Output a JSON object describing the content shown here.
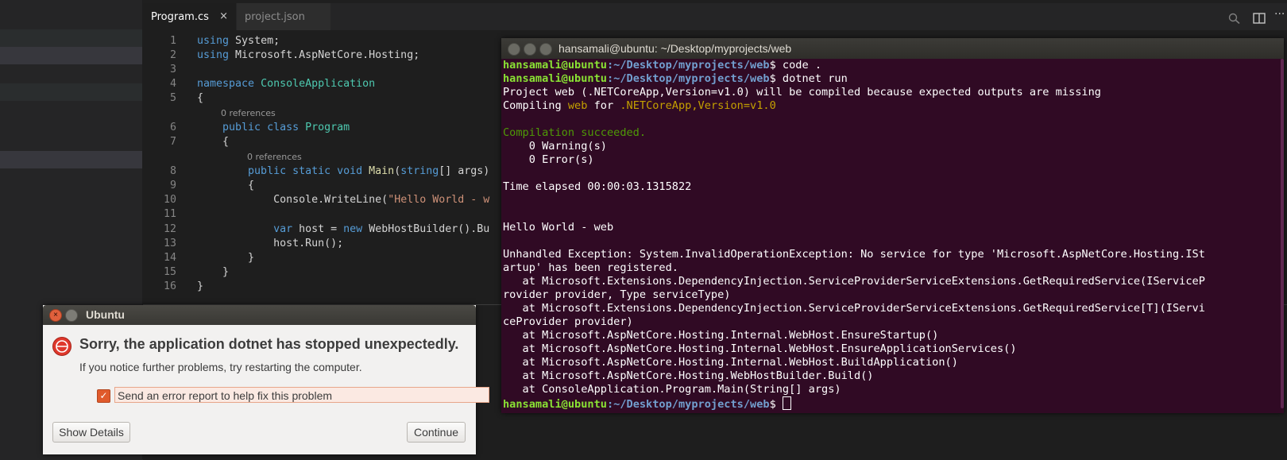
{
  "editor": {
    "tabs": [
      {
        "label": "Program.cs",
        "close": "×"
      },
      {
        "label": "project.json"
      }
    ],
    "lines": [
      {
        "n": "1",
        "parts": [
          [
            "kw",
            "using"
          ],
          [
            "",
            "System;"
          ]
        ]
      },
      {
        "n": "2",
        "parts": [
          [
            "kw",
            "using"
          ],
          [
            "",
            "Microsoft.AspNetCore.Hosting;"
          ]
        ]
      },
      {
        "n": "3",
        "parts": []
      },
      {
        "n": "4",
        "parts": [
          [
            "kw",
            "namespace"
          ],
          [
            "ty",
            "ConsoleApplication"
          ]
        ]
      },
      {
        "n": "5",
        "parts": [
          [
            "",
            "{"
          ]
        ]
      },
      {
        "n": "6",
        "parts": [
          [
            "kw",
            "public class"
          ],
          [
            "ty",
            "Program"
          ]
        ]
      },
      {
        "n": "7",
        "parts": [
          [
            "",
            "{"
          ]
        ]
      },
      {
        "n": "8",
        "parts": [
          [
            "kw",
            "public static void"
          ],
          [
            "fn",
            "Main"
          ],
          [
            "",
            "("
          ],
          [
            "kw",
            "string"
          ],
          [
            "",
            "[] args)"
          ]
        ]
      },
      {
        "n": "9",
        "parts": [
          [
            "",
            "{"
          ]
        ]
      },
      {
        "n": "10",
        "parts": [
          [
            "",
            "Console.WriteLine("
          ],
          [
            "st",
            "\"Hello World - w"
          ]
        ]
      },
      {
        "n": "11",
        "parts": []
      },
      {
        "n": "12",
        "parts": [
          [
            "kw",
            "var"
          ],
          [
            "",
            "host ="
          ],
          [
            "kw",
            "new"
          ],
          [
            "",
            "WebHostBuilder().Bu"
          ]
        ]
      },
      {
        "n": "13",
        "parts": [
          [
            "",
            "host.Run();"
          ]
        ]
      },
      {
        "n": "14",
        "parts": [
          [
            "",
            "}"
          ]
        ]
      },
      {
        "n": "15",
        "parts": [
          [
            "",
            "}"
          ]
        ]
      },
      {
        "n": "16",
        "parts": [
          [
            "",
            "}"
          ]
        ]
      }
    ],
    "references": "0 references"
  },
  "terminal": {
    "title": "hansamali@ubuntu: ~/Desktop/myprojects/web",
    "prompt_user": "hansamali@ubuntu",
    "prompt_path": ":~/Desktop/myprojects/web",
    "cmd1": "$ code .",
    "cmd2": "$ dotnet run",
    "out": [
      "Project web (.NETCoreApp,Version=v1.0) will be compiled because expected outputs are missing",
      "Compiling ",
      "web",
      " for ",
      ".NETCoreApp,Version=v1.0",
      "Compilation succeeded.",
      "    0 Warning(s)",
      "    0 Error(s)",
      "Time elapsed 00:00:03.1315822",
      "Hello World - web",
      "Unhandled Exception: System.InvalidOperationException: No service for type 'Microsoft.AspNetCore.Hosting.ISt",
      "artup' has been registered.",
      "   at Microsoft.Extensions.DependencyInjection.ServiceProviderServiceExtensions.GetRequiredService(IServiceP",
      "rovider provider, Type serviceType)",
      "   at Microsoft.Extensions.DependencyInjection.ServiceProviderServiceExtensions.GetRequiredService[T](IServi",
      "ceProvider provider)",
      "   at Microsoft.AspNetCore.Hosting.Internal.WebHost.EnsureStartup()",
      "   at Microsoft.AspNetCore.Hosting.Internal.WebHost.EnsureApplicationServices()",
      "   at Microsoft.AspNetCore.Hosting.Internal.WebHost.BuildApplication()",
      "   at Microsoft.AspNetCore.Hosting.WebHostBuilder.Build()",
      "   at ConsoleApplication.Program.Main(String[] args)"
    ],
    "final_prompt_end": "$ "
  },
  "dialog": {
    "title": "Ubuntu",
    "close_glyph": "×",
    "heading": "Sorry, the application dotnet has stopped unexpectedly.",
    "subtext": "If you notice further problems, try restarting the computer.",
    "checkbox_mark": "✓",
    "checkbox_label": "Send an error report to help fix this problem",
    "show_details": "Show Details",
    "continue": "Continue"
  },
  "icons": {
    "toolbar": [
      "split-editor-icon",
      "open-changes-icon",
      "more-actions-icon"
    ],
    "more_glyph": "···"
  },
  "colors": {
    "terminal_bg": "#300a24",
    "prompt_user": "#8ae234",
    "prompt_path": "#729fcf",
    "dialog_accent": "#e05a2b"
  }
}
